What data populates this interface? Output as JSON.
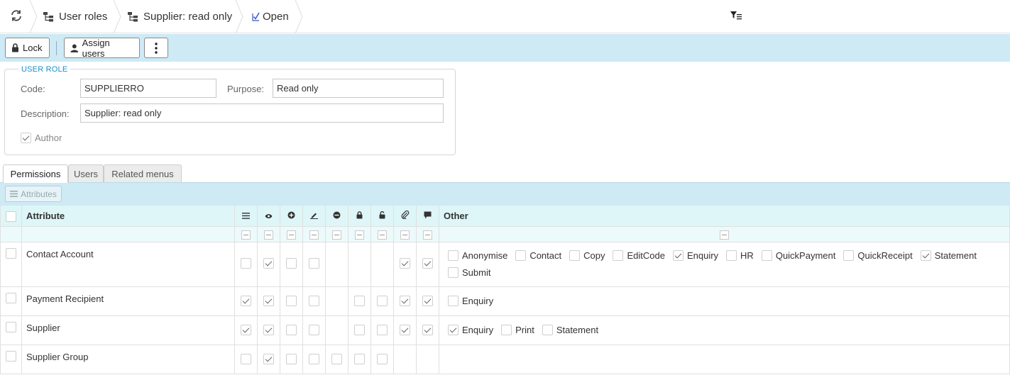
{
  "breadcrumb": {
    "items": [
      "User roles",
      "Supplier: read only",
      "Open"
    ]
  },
  "toolbar": {
    "lock_label": "Lock",
    "assign_users_label": "Assign users"
  },
  "user_role": {
    "legend": "USER ROLE",
    "code_label": "Code:",
    "code_value": "SUPPLIERRO",
    "purpose_label": "Purpose:",
    "purpose_value": "Read only",
    "description_label": "Description:",
    "description_value": "Supplier: read only",
    "author_label": "Author",
    "author_checked": true
  },
  "tabs": [
    "Permissions",
    "Users",
    "Related menus"
  ],
  "attributes_button": "Attributes",
  "grid": {
    "columns": {
      "attribute": "Attribute",
      "other": "Other"
    },
    "permission_icons": [
      "list-icon",
      "eye-icon",
      "plus-circle-icon",
      "pencil-icon",
      "minus-circle-icon",
      "lock-icon",
      "unlock-icon",
      "paperclip-icon",
      "comment-icon"
    ],
    "rows": [
      {
        "name": "Contact Account",
        "perms": [
          false,
          true,
          false,
          false,
          null,
          null,
          null,
          true,
          true
        ],
        "other": [
          {
            "label": "Anonymise",
            "checked": false
          },
          {
            "label": "Contact",
            "checked": false
          },
          {
            "label": "Copy",
            "checked": false
          },
          {
            "label": "EditCode",
            "checked": false
          },
          {
            "label": "Enquiry",
            "checked": true
          },
          {
            "label": "HR",
            "checked": false
          },
          {
            "label": "QuickPayment",
            "checked": false
          },
          {
            "label": "QuickReceipt",
            "checked": false
          },
          {
            "label": "Statement",
            "checked": true
          },
          {
            "label": "Submit",
            "checked": false
          }
        ]
      },
      {
        "name": "Payment Recipient",
        "perms": [
          true,
          true,
          false,
          false,
          null,
          false,
          false,
          true,
          true
        ],
        "other": [
          {
            "label": "Enquiry",
            "checked": false
          }
        ]
      },
      {
        "name": "Supplier",
        "perms": [
          true,
          true,
          false,
          false,
          null,
          false,
          false,
          true,
          true
        ],
        "other": [
          {
            "label": "Enquiry",
            "checked": true
          },
          {
            "label": "Print",
            "checked": false
          },
          {
            "label": "Statement",
            "checked": false
          }
        ]
      },
      {
        "name": "Supplier Group",
        "perms": [
          false,
          true,
          false,
          false,
          false,
          false,
          false,
          null,
          null
        ],
        "other": []
      }
    ]
  }
}
